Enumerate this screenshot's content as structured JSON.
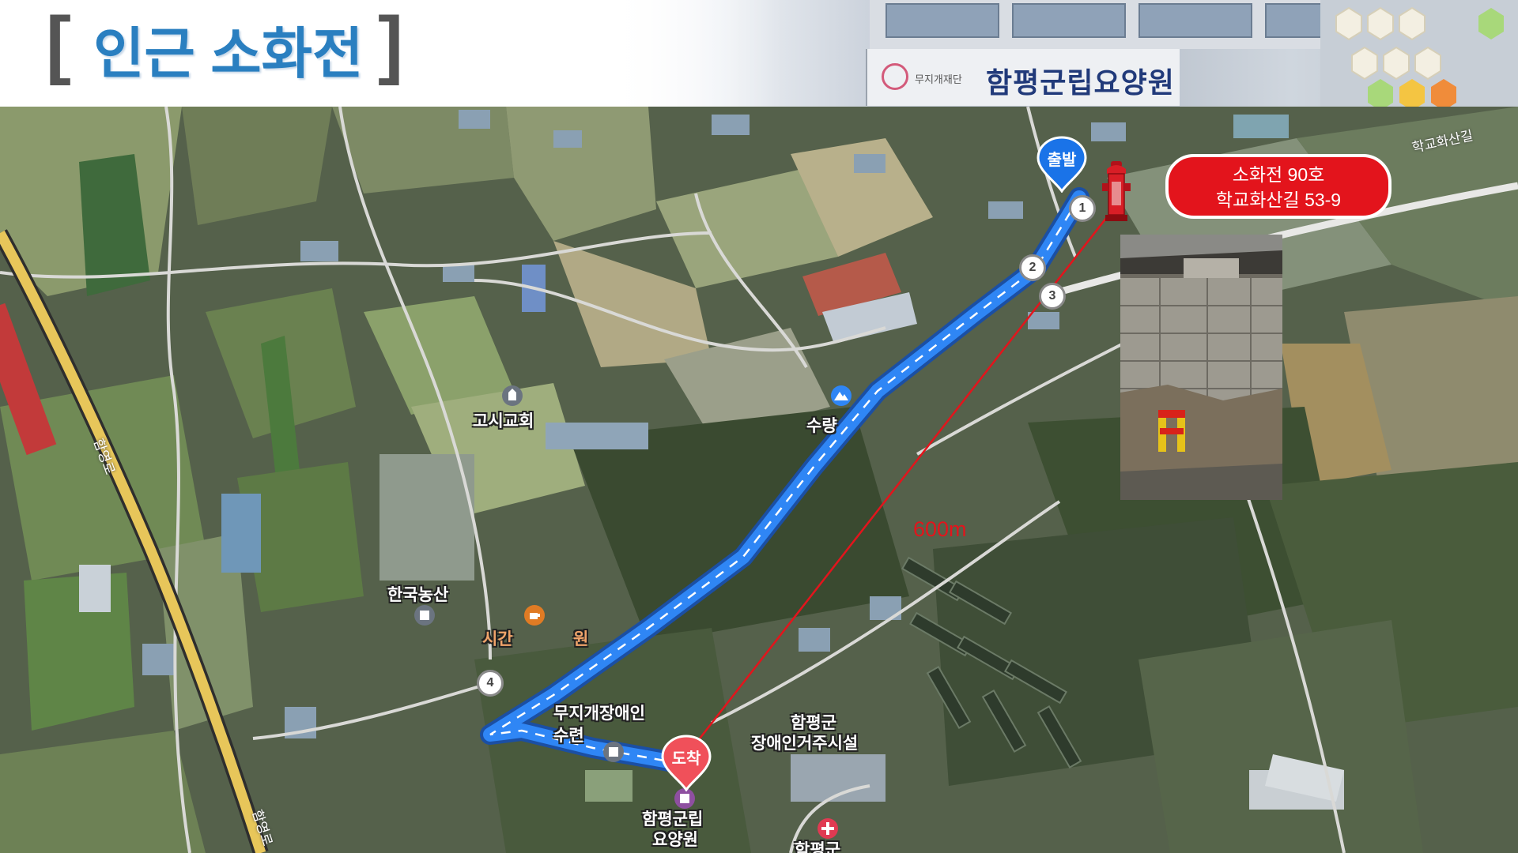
{
  "header": {
    "title": "인근 소화전",
    "bracket_left": "[",
    "bracket_right": "]",
    "background_photo": {
      "sign_text": "함평군립요양원",
      "sign_small_text": "무지개재단"
    }
  },
  "map": {
    "markers": {
      "start": "출발",
      "end": "도착"
    },
    "waypoints": [
      "1",
      "2",
      "3",
      "4"
    ],
    "hydrant_callout": {
      "line1": "소화전 90호",
      "line2": "학교화산길 53-9"
    },
    "distance_label": "600m",
    "place_labels": {
      "gosi_church": "고시교회",
      "suryang": "수량",
      "hanguk_nongsan": "한국농산",
      "sigan": "시간",
      "sigan_suffix": "원",
      "rainbow_center_line1": "무지개장애인",
      "rainbow_center_line2": "수련",
      "hampyeong_gun": "함평군",
      "disabled_housing": "장애인거주시설",
      "nursing_home_line1": "함평군립",
      "nursing_home_line2": "요양원",
      "hampyeong_bottom": "함평군"
    },
    "road_labels": {
      "school_road": "학교화산길",
      "expressway_top": "함영로",
      "expressway_bottom": "함영로"
    },
    "icons": {
      "hydrant": "fire-hydrant-icon",
      "start_pin": "start-pin-icon",
      "end_pin": "end-pin-icon",
      "church": "church-icon",
      "mountain": "mountain-icon",
      "cafe": "cafe-icon",
      "building": "building-icon",
      "hospital": "hospital-icon"
    },
    "colors": {
      "route": "#2f86f5",
      "callout": "#e3141c",
      "distance_line": "#e3141c",
      "expressway": "#e7c65a",
      "title": "#2a7fc0"
    }
  }
}
